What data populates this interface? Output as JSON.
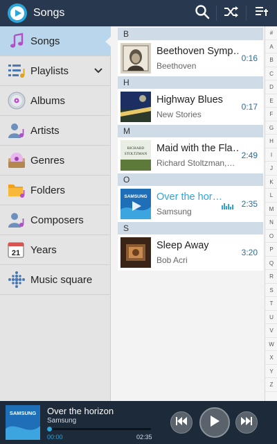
{
  "header": {
    "title": "Songs",
    "search_icon": "search-icon",
    "shuffle_icon": "shuffle-icon",
    "add_playlist_icon": "playlist-add-icon"
  },
  "sidebar": {
    "items": [
      {
        "label": "Songs",
        "icon": "music-note-icon",
        "active": true
      },
      {
        "label": "Playlists",
        "icon": "playlists-icon",
        "expandable": true
      },
      {
        "label": "Albums",
        "icon": "album-icon"
      },
      {
        "label": "Artists",
        "icon": "artist-icon"
      },
      {
        "label": "Genres",
        "icon": "genres-icon"
      },
      {
        "label": "Folders",
        "icon": "folder-icon"
      },
      {
        "label": "Composers",
        "icon": "composer-icon"
      },
      {
        "label": "Years",
        "icon": "calendar-icon",
        "icon_text": "21"
      },
      {
        "label": "Music square",
        "icon": "music-square-icon"
      }
    ]
  },
  "song_sections": [
    {
      "letter": "B",
      "songs": [
        {
          "title": "Beethoven Symp…",
          "artist": "Beethoven",
          "duration": "0:16"
        }
      ]
    },
    {
      "letter": "H",
      "songs": [
        {
          "title": "Highway Blues",
          "artist": "New Stories",
          "duration": "0:17"
        }
      ]
    },
    {
      "letter": "M",
      "songs": [
        {
          "title": "Maid with the Fla…",
          "artist": "Richard Stoltzman,…",
          "duration": "2:49",
          "art_text": "RICHARD STOLTZMAN"
        }
      ]
    },
    {
      "letter": "O",
      "songs": [
        {
          "title": "Over the hor…",
          "artist": "Samsung",
          "duration": "2:35",
          "playing": true,
          "art_text": "SAMSUNG"
        }
      ]
    },
    {
      "letter": "S",
      "songs": [
        {
          "title": "Sleep Away",
          "artist": "Bob Acri",
          "duration": "3:20"
        }
      ]
    }
  ],
  "alphabet_index": [
    "#",
    "A",
    "B",
    "C",
    "D",
    "E",
    "F",
    "G",
    "H",
    "I",
    "J",
    "K",
    "L",
    "M",
    "N",
    "O",
    "P",
    "Q",
    "R",
    "S",
    "T",
    "U",
    "V",
    "W",
    "X",
    "Y",
    "Z"
  ],
  "player": {
    "title": "Over the horizon",
    "artist": "Samsung",
    "current_time": "00:00",
    "total_time": "02:35",
    "progress": 0,
    "art_text": "SAMSUNG"
  },
  "colors": {
    "accent": "#2aa6dc",
    "header_bg": "#27384f",
    "player_bg": "#1c2a3a",
    "active_item_bg": "#b9d6ec"
  }
}
